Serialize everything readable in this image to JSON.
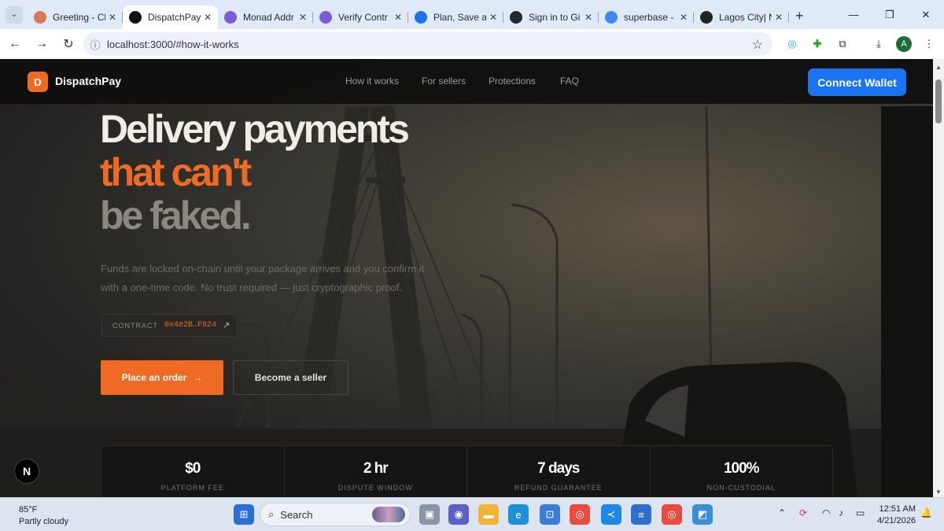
{
  "browser": {
    "tabs": [
      {
        "title": "Greeting - Cl",
        "favicon": "claude-icon",
        "color": "#d97757",
        "active": false
      },
      {
        "title": "DispatchPay",
        "favicon": "triangle-icon",
        "color": "#111111",
        "active": true
      },
      {
        "title": "Monad Addr",
        "favicon": "monad-icon",
        "color": "#7b5cd6",
        "active": false
      },
      {
        "title": "Verify Contr",
        "favicon": "monad-icon",
        "color": "#7b5cd6",
        "active": false
      },
      {
        "title": "Plan, Save ar",
        "favicon": "plan-icon",
        "color": "#1a73e8",
        "active": false
      },
      {
        "title": "Sign in to Gi",
        "favicon": "github-icon",
        "color": "#24292f",
        "active": false
      },
      {
        "title": "superbase -",
        "favicon": "google-icon",
        "color": "#4285f4",
        "active": false
      },
      {
        "title": "Lagos City| N",
        "favicon": "lagos-icon",
        "color": "#222222",
        "active": false
      }
    ],
    "url": "localhost:3000/#how-it-works"
  },
  "site": {
    "logo_letter": "D",
    "brand": "DispatchPay",
    "nav": [
      "How it works",
      "For sellers",
      "Protections",
      "FAQ"
    ],
    "connect_label": "Connect Wallet",
    "accent": "#ef6a24",
    "connect_color": "#1a73f0"
  },
  "hero": {
    "line1": "Delivery payments",
    "line2": "that can't",
    "line3": "be faked.",
    "subtitle": "Funds are locked on-chain until your package arrives and you confirm it with a one-time code. No trust required — just cryptographic proof.",
    "contract_label": "CONTRACT",
    "contract_address": "0x4e2B…F924",
    "primary_cta": "Place an order",
    "secondary_cta": "Become a seller"
  },
  "stats": [
    {
      "value": "$0",
      "label": "PLATFORM FEE"
    },
    {
      "value": "2 hr",
      "label": "DISPUTE WINDOW"
    },
    {
      "value": "7 days",
      "label": "REFUND GUARANTEE"
    },
    {
      "value": "100%",
      "label": "NON-CUSTODIAL"
    }
  ],
  "dev_badge": "N",
  "taskbar": {
    "temperature": "85°F",
    "condition": "Partly cloudy",
    "search_label": "Search",
    "time": "12:51 AM",
    "date": "4/21/2026"
  }
}
